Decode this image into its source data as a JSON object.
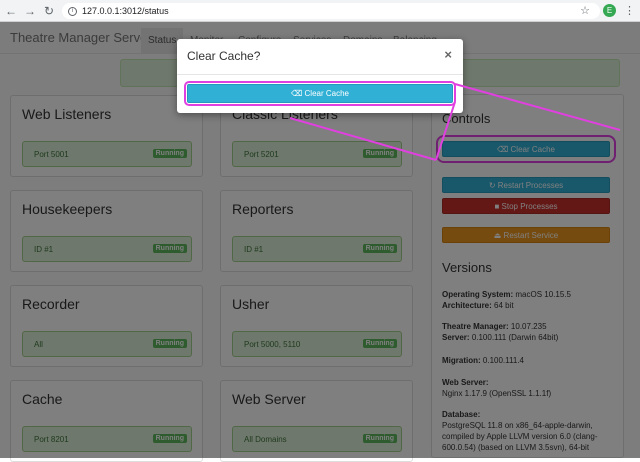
{
  "browser": {
    "url": "127.0.0.1:3012/status",
    "profile_initial": "E"
  },
  "navbar": {
    "brand": "Theatre Manager Server",
    "tabs": [
      "Status",
      "Monitor",
      "Configure",
      "Services",
      "Domains",
      "Balancing"
    ]
  },
  "panels": [
    {
      "title": "Web Listeners",
      "row": "Port 5001",
      "badge": "Running"
    },
    {
      "title": "Classic Listeners",
      "row": "Port 5201",
      "badge": "Running"
    },
    {
      "title": "Housekeepers",
      "row": "ID #1",
      "badge": "Running"
    },
    {
      "title": "Reporters",
      "row": "ID #1",
      "badge": "Running"
    },
    {
      "title": "Recorder",
      "row": "All",
      "badge": "Running"
    },
    {
      "title": "Usher",
      "row": "Port 5000, 5110",
      "badge": "Running"
    },
    {
      "title": "Cache",
      "row": "Port 8201",
      "badge": "Running"
    },
    {
      "title": "Web Server",
      "row": "All Domains",
      "badge": "Running"
    }
  ],
  "controls": {
    "title": "Controls",
    "clear_cache": "Clear Cache",
    "restart_processes": "Restart Processes",
    "stop_processes": "Stop Processes",
    "restart_service": "Restart Service"
  },
  "versions": {
    "title": "Versions",
    "os_label": "Operating System:",
    "os_value": "macOS 10.15.5",
    "arch_label": "Architecture:",
    "arch_value": "64 bit",
    "tm_label": "Theatre Manager:",
    "tm_value": "10.07.235",
    "server_label": "Server:",
    "server_value": "0.100.111 (Darwin 64bit)",
    "migration_label": "Migration:",
    "migration_value": "0.100.111.4",
    "webserver_label": "Web Server:",
    "webserver_value": "Nginx 1.17.9 (OpenSSL 1.1.1f)",
    "db_label": "Database:",
    "db_value": "PostgreSQL 11.8 on x86_64-apple-darwin, compiled by Apple LLVM version 6.0 (clang-600.0.54) (based on LLVM 3.5svn), 64-bit"
  },
  "modal": {
    "title": "Clear Cache?",
    "close": "×",
    "button": "Clear Cache"
  }
}
